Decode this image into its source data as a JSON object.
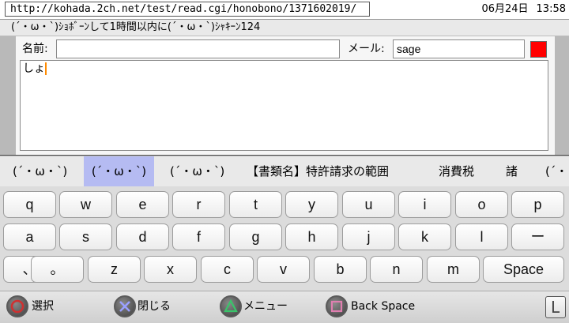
{
  "topbar": {
    "url": "http://kohada.2ch.net/test/read.cgi/honobono/1371602019/",
    "date": "06月24日",
    "time": "13:58"
  },
  "thread": {
    "title": "(´・ω・`)ｼｮﾎﾞｰﾝして1時間以内に(´・ω・`)ｼｬｷｰﾝ124"
  },
  "form": {
    "name_label": "名前:",
    "name_value": "",
    "mail_label": "メール:",
    "mail_value": "sage",
    "body_text": "しょ",
    "swatch_color": "#ff0000"
  },
  "candidates": [
    "(´・ω・`)",
    "(´・ω・`)",
    "(´・ω・`)",
    "【書類名】特許請求の範囲",
    "消費税",
    "諸",
    "(´・"
  ],
  "selected_candidate_index": 1,
  "keyboard": {
    "row1": [
      "q",
      "w",
      "e",
      "r",
      "t",
      "y",
      "u",
      "i",
      "o",
      "p"
    ],
    "row2": [
      "a",
      "s",
      "d",
      "f",
      "g",
      "h",
      "j",
      "k",
      "l",
      "ー"
    ],
    "row3": [
      "、",
      "。",
      "z",
      "x",
      "c",
      "v",
      "b",
      "n",
      "m"
    ],
    "space_label": "Space"
  },
  "help": {
    "circle_label": "選択",
    "cross_label": "閉じる",
    "triangle_label": "メニュー",
    "square_label": "Back Space",
    "l_label": "L"
  },
  "colors": {
    "circle": "#d03030",
    "cross": "#9aa0ff",
    "triangle": "#39c46a",
    "square": "#e07fb0",
    "selection": "#b5bbf2"
  }
}
